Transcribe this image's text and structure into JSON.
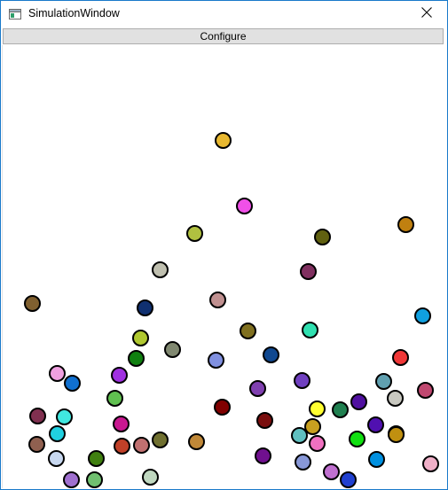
{
  "window": {
    "title": "SimulationWindow"
  },
  "toolbar": {
    "configure_label": "Configure"
  },
  "icons": {
    "app": "window-app-icon",
    "close": "close-icon"
  },
  "balls": [
    {
      "color": "#e8b830"
    },
    {
      "color": "#f050e8"
    },
    {
      "color": "#b0c040"
    },
    {
      "color": "#606010"
    },
    {
      "color": "#c08010"
    },
    {
      "color": "#c0c0b0"
    },
    {
      "color": "#803060"
    },
    {
      "color": "#806030"
    },
    {
      "color": "#c09090"
    },
    {
      "color": "#103070"
    },
    {
      "color": "#10a0e0"
    },
    {
      "color": "#b0c830"
    },
    {
      "color": "#807020"
    },
    {
      "color": "#30e0b0"
    },
    {
      "color": "#108010"
    },
    {
      "color": "#808870"
    },
    {
      "color": "#8090e0"
    },
    {
      "color": "#104890"
    },
    {
      "color": "#f0a0e0"
    },
    {
      "color": "#1070d0"
    },
    {
      "color": "#a030e0"
    },
    {
      "color": "#f03838"
    },
    {
      "color": "#60c050"
    },
    {
      "color": "#8040b0"
    },
    {
      "color": "#7040c0"
    },
    {
      "color": "#60a0b0"
    },
    {
      "color": "#c04870"
    },
    {
      "color": "#c8c8c0"
    },
    {
      "color": "#800000"
    },
    {
      "color": "#ffff30"
    },
    {
      "color": "#208050"
    },
    {
      "color": "#5010a0"
    },
    {
      "color": "#803050"
    },
    {
      "color": "#40e8e0"
    },
    {
      "color": "#c81890"
    },
    {
      "color": "#7a0e0e"
    },
    {
      "color": "#c8a020"
    },
    {
      "color": "#5010b0"
    },
    {
      "color": "#60c0c0"
    },
    {
      "color": "#20d0e0"
    },
    {
      "color": "#906050"
    },
    {
      "color": "#c04028"
    },
    {
      "color": "#c07070"
    },
    {
      "color": "#707030"
    },
    {
      "color": "#c08838"
    },
    {
      "color": "#70b0b0"
    },
    {
      "color": "#f070c0"
    },
    {
      "color": "#10e010"
    },
    {
      "color": "#c09010"
    },
    {
      "color": "#c8d8f0"
    },
    {
      "color": "#408010"
    },
    {
      "color": "#70108f"
    },
    {
      "color": "#8898d8"
    },
    {
      "color": "#0090e0"
    },
    {
      "color": "#f0b0c8"
    },
    {
      "color": "#a070d0"
    },
    {
      "color": "#70c070"
    },
    {
      "color": "#c0d8c0"
    },
    {
      "color": "#c070d0"
    },
    {
      "color": "#2040d0"
    }
  ]
}
